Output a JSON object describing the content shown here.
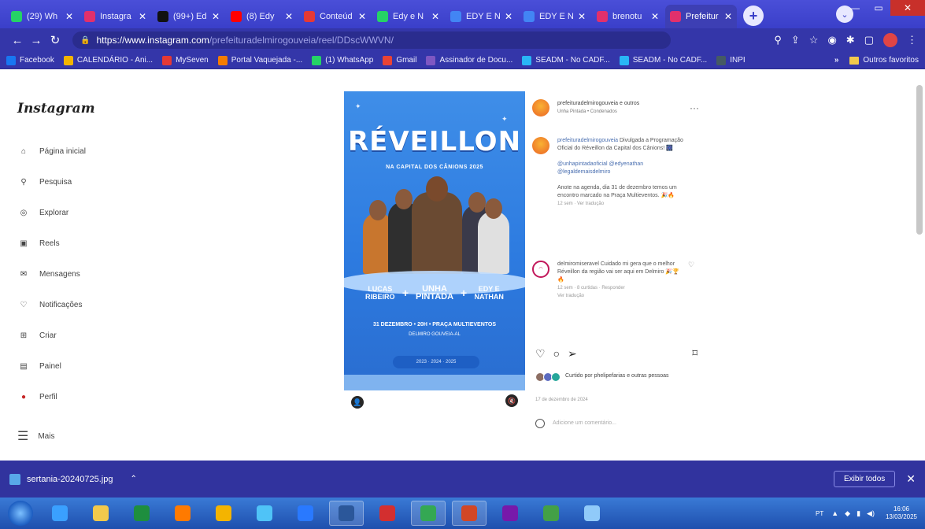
{
  "browser": {
    "tabs": [
      {
        "label": "(29) Wh",
        "color": "#25d366"
      },
      {
        "label": "Instagra",
        "color": "#e1306c"
      },
      {
        "label": "(99+) Ed",
        "color": "#111111"
      },
      {
        "label": "(8) Edy",
        "color": "#ff0000"
      },
      {
        "label": "Conteúd",
        "color": "#e53935"
      },
      {
        "label": "Edy e N",
        "color": "#25d366"
      },
      {
        "label": "EDY E N",
        "color": "#4285f4"
      },
      {
        "label": "EDY E N",
        "color": "#4285f4"
      },
      {
        "label": "brenotu",
        "color": "#e1306c"
      },
      {
        "label": "Prefeitur",
        "color": "#e1306c"
      }
    ],
    "url_host": "https://www.instagram.com",
    "url_path": "/prefeituradelmirogouveia/reel/DDscWWVN/",
    "bookmarks": [
      {
        "label": "Facebook",
        "color": "#1877f2"
      },
      {
        "label": "CALENDÁRIO - Ani...",
        "color": "#f4b400"
      },
      {
        "label": "MySeven",
        "color": "#e53935"
      },
      {
        "label": "Portal Vaquejada -...",
        "color": "#f57c00"
      },
      {
        "label": "(1) WhatsApp",
        "color": "#25d366"
      },
      {
        "label": "Gmail",
        "color": "#ea4335"
      },
      {
        "label": "Assinador de Docu...",
        "color": "#7e57c2"
      },
      {
        "label": "SEADM - No CADF...",
        "color": "#29b6f6"
      },
      {
        "label": "SEADM - No CADF...",
        "color": "#29b6f6"
      },
      {
        "label": "INPI",
        "color": "#455a64"
      }
    ],
    "other_bookmarks": "Outros favoritos"
  },
  "instagram": {
    "logo": "Instagram",
    "nav": [
      {
        "label": "Página inicial",
        "icon": "home-icon",
        "glyph": "⌂"
      },
      {
        "label": "Pesquisa",
        "icon": "search-icon",
        "glyph": "⚲"
      },
      {
        "label": "Explorar",
        "icon": "explore-icon",
        "glyph": "◎"
      },
      {
        "label": "Reels",
        "icon": "reels-icon",
        "glyph": "▣"
      },
      {
        "label": "Mensagens",
        "icon": "messages-icon",
        "glyph": "✉"
      },
      {
        "label": "Notificações",
        "icon": "heart-icon",
        "glyph": "♡"
      },
      {
        "label": "Criar",
        "icon": "create-icon",
        "glyph": "⊞"
      },
      {
        "label": "Painel",
        "icon": "dashboard-icon",
        "glyph": "▤"
      },
      {
        "label": "Perfil",
        "icon": "profile-icon",
        "glyph": "●"
      }
    ],
    "more": "Mais",
    "poster": {
      "title": "RÉVEILLON",
      "subtitle": "NA CAPITAL DOS CÂNIONS 2025",
      "artists": [
        "LUCAS RIBEIRO",
        "UNHA PINTADA",
        "EDY E NATHAN"
      ],
      "date": "31 DEZEMBRO • 20H • PRAÇA MULTIEVENTOS",
      "location": "DELMIRO GOUVEIA-AL",
      "pill": "2023 · 2024 · 2025"
    },
    "post": {
      "author": "prefeituradelmirogouveia e outros",
      "collab": "Unha Pintada • Condenados",
      "caption_user": "prefeituradelmirogouveia",
      "caption": "Divulgada a Programação Oficial do Réveillon da Capital dos Cânions! 🎆",
      "mentions": "@unhapintadaoficial @edyenathan @legaldemaisdelmiro",
      "caption2": "Anote na agenda, dia 31 de dezembro temos um encontro marcado na Praça Multieventos. 🎉🔥",
      "caption_meta": "12 sem · Ver tradução",
      "comment_user": "delmiromiseravel",
      "comment": "Cuidado mi gera que o melhor Réveillon da região vai ser aqui em Delmiro 🎉🏆🔥",
      "comment_meta": "12 sem · 8 curtidas · Responder",
      "comment_translate": "Ver tradução",
      "likes": "Curtido por phelipefarias e outras pessoas",
      "date": "17 de dezembro de 2024",
      "add_comment": "Adicione um comentário..."
    }
  },
  "downloads": {
    "file": "sertania-20240725.jpg",
    "show_all": "Exibir todos"
  },
  "taskbar": {
    "apps": [
      {
        "name": "ie",
        "color": "#3aa0ff"
      },
      {
        "name": "explorer",
        "color": "#f2c94c"
      },
      {
        "name": "excel",
        "color": "#1e8e3e"
      },
      {
        "name": "media",
        "color": "#ff7a00"
      },
      {
        "name": "chrome",
        "color": "#f4b400"
      },
      {
        "name": "app6",
        "color": "#4fc3f7"
      },
      {
        "name": "app7",
        "color": "#2979ff"
      },
      {
        "name": "word",
        "color": "#2b579a"
      },
      {
        "name": "acrobat",
        "color": "#d32f2f"
      },
      {
        "name": "chrome2",
        "color": "#34a853"
      },
      {
        "name": "powerpoint",
        "color": "#d24726"
      },
      {
        "name": "onenote",
        "color": "#7719aa"
      },
      {
        "name": "app13",
        "color": "#43a047"
      },
      {
        "name": "paint",
        "color": "#90caf9"
      }
    ],
    "lang": "PT",
    "time": "16:06",
    "date": "13/03/2025"
  }
}
